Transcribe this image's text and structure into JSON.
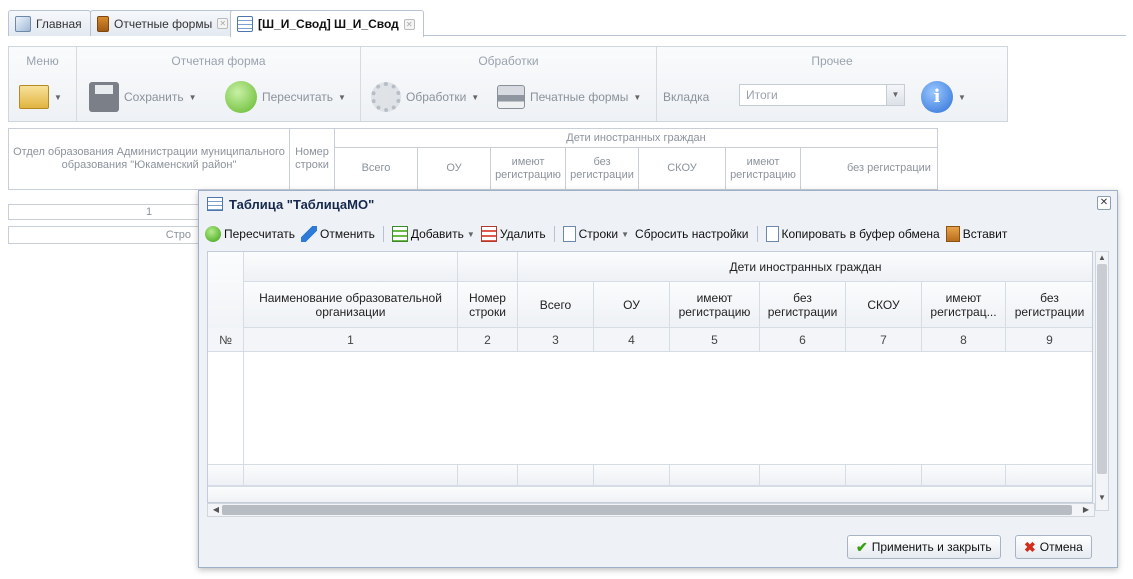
{
  "tabs": [
    {
      "label": "Главная",
      "icon": "home-icon",
      "closable": false
    },
    {
      "label": "Отчетные формы",
      "icon": "book-icon",
      "closable": true
    },
    {
      "label": "[Ш_И_Свод] Ш_И_Свод",
      "icon": "table-icon",
      "closable": true,
      "active": true
    }
  ],
  "ribbon": {
    "groups": {
      "menu": "Меню",
      "report_form": "Отчетная форма",
      "processing": "Обработки",
      "other": "Прочее"
    },
    "save_label": "Сохранить",
    "recalc_label": "Пересчитать",
    "processing_label": "Обработки",
    "print_label": "Печатные формы",
    "tab_label": "Вкладка",
    "tab_value": "Итоги"
  },
  "bg_table": {
    "org_header": "Отдел образования Администрации муниципального образования \"Юкаменский район\"",
    "row_num_header": "Номер строки",
    "foreign_children": "Дети иностранных граждан",
    "cols": [
      "Всего",
      "ОУ",
      "имеют регистрацию",
      "без регистрации",
      "СКОУ",
      "имеют регистрацию",
      "без регистрации"
    ],
    "index_1": "1",
    "rows_label": "Стро"
  },
  "modal": {
    "title": "Таблица \"ТаблицаМО\"",
    "close_glyph": "✕",
    "toolbar": {
      "recalc": "Пересчитать",
      "undo": "Отменить",
      "add": "Добавить",
      "delete": "Удалить",
      "rows": "Строки",
      "reset": "Сбросить настройки",
      "copy": "Копировать в буфер обмена",
      "paste": "Вставит"
    },
    "grid": {
      "group_header": "Дети иностранных граждан",
      "columns": [
        "Наименование образовательной организации",
        "Номер строки",
        "Всего",
        "ОУ",
        "имеют регистрацию",
        "без регистрации",
        "СКОУ",
        "имеют регистрац...",
        "без регистрации"
      ],
      "num_label": "№",
      "col_numbers": [
        "1",
        "2",
        "3",
        "4",
        "5",
        "6",
        "7",
        "8",
        "9"
      ]
    },
    "apply_label": "Применить и закрыть",
    "cancel_label": "Отмена"
  }
}
